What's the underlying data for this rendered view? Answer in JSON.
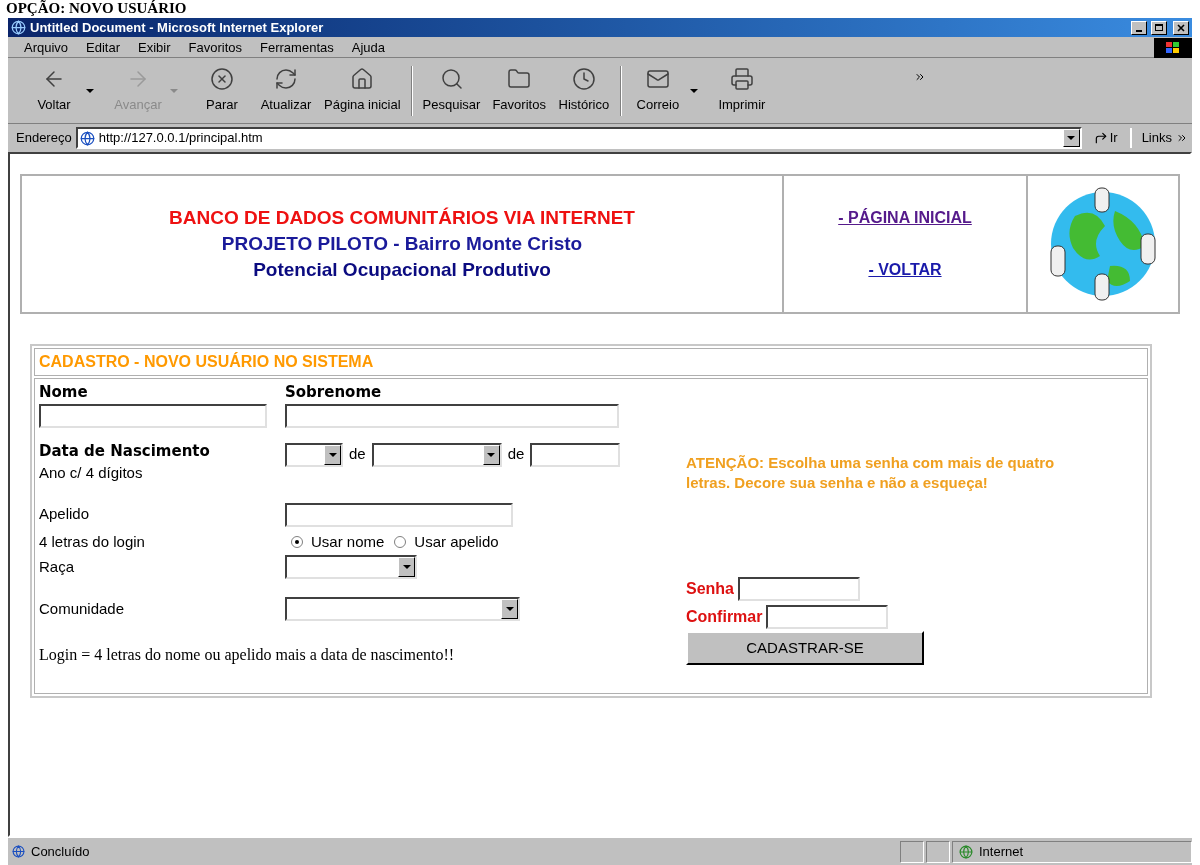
{
  "page_heading": "OPÇÃO: NOVO USUÁRIO",
  "window": {
    "title": "Untitled Document - Microsoft Internet Explorer"
  },
  "menu": [
    "Arquivo",
    "Editar",
    "Exibir",
    "Favoritos",
    "Ferramentas",
    "Ajuda"
  ],
  "toolbar": [
    {
      "kind": "back",
      "label": "Voltar",
      "disabled": false,
      "dropdown": true
    },
    {
      "kind": "forward",
      "label": "Avançar",
      "disabled": true,
      "dropdown": true
    },
    {
      "kind": "stop",
      "label": "Parar",
      "disabled": false,
      "dropdown": false
    },
    {
      "kind": "refresh",
      "label": "Atualizar",
      "disabled": false,
      "dropdown": false
    },
    {
      "kind": "home",
      "label": "Página inicial",
      "disabled": false,
      "dropdown": false
    },
    {
      "kind": "search",
      "label": "Pesquisar",
      "disabled": false,
      "dropdown": false
    },
    {
      "kind": "favorites",
      "label": "Favoritos",
      "disabled": false,
      "dropdown": false
    },
    {
      "kind": "history",
      "label": "Histórico",
      "disabled": false,
      "dropdown": false
    },
    {
      "kind": "mail",
      "label": "Correio",
      "disabled": false,
      "dropdown": true
    },
    {
      "kind": "print",
      "label": "Imprimir",
      "disabled": false,
      "dropdown": false
    }
  ],
  "address_bar": {
    "label": "Endereço",
    "value": "http://127.0.0.1/principal.htm",
    "go": "Ir",
    "links": "Links"
  },
  "banner": {
    "title": "BANCO DE DADOS COMUNITÁRIOS VIA INTERNET",
    "subtitle": "PROJETO PILOTO - Bairro Monte Cristo",
    "tagline": "Potencial Ocupacional Produtivo",
    "links": [
      "- PÁGINA INICIAL",
      "- VOLTAR"
    ]
  },
  "form": {
    "title": "CADASTRO - NOVO USUÁRIO NO SISTEMA",
    "nome": "Nome",
    "sobrenome": "Sobrenome",
    "birth_label": "Data de Nascimento",
    "birth_hint": "Ano c/ 4 dígitos",
    "de_1": "de",
    "de_2": "de",
    "apelido": "Apelido",
    "login_letters": "4 letras do login",
    "login_options": [
      {
        "label": "Usar nome",
        "selected": true
      },
      {
        "label": "Usar apelido",
        "selected": false
      }
    ],
    "raca": "Raça",
    "comunidade": "Comunidade",
    "login_note": "Login = 4 letras do nome ou apelido mais a data de nascimento!!",
    "warning": "ATENÇÃO: Escolha uma senha com mais de quatro letras. Decore sua senha e não a esqueça!",
    "senha": "Senha",
    "confirmar": "Confirmar",
    "submit": "CADASTRAR-SE"
  },
  "status_bar": {
    "text": "Concluído",
    "zone": "Internet"
  }
}
